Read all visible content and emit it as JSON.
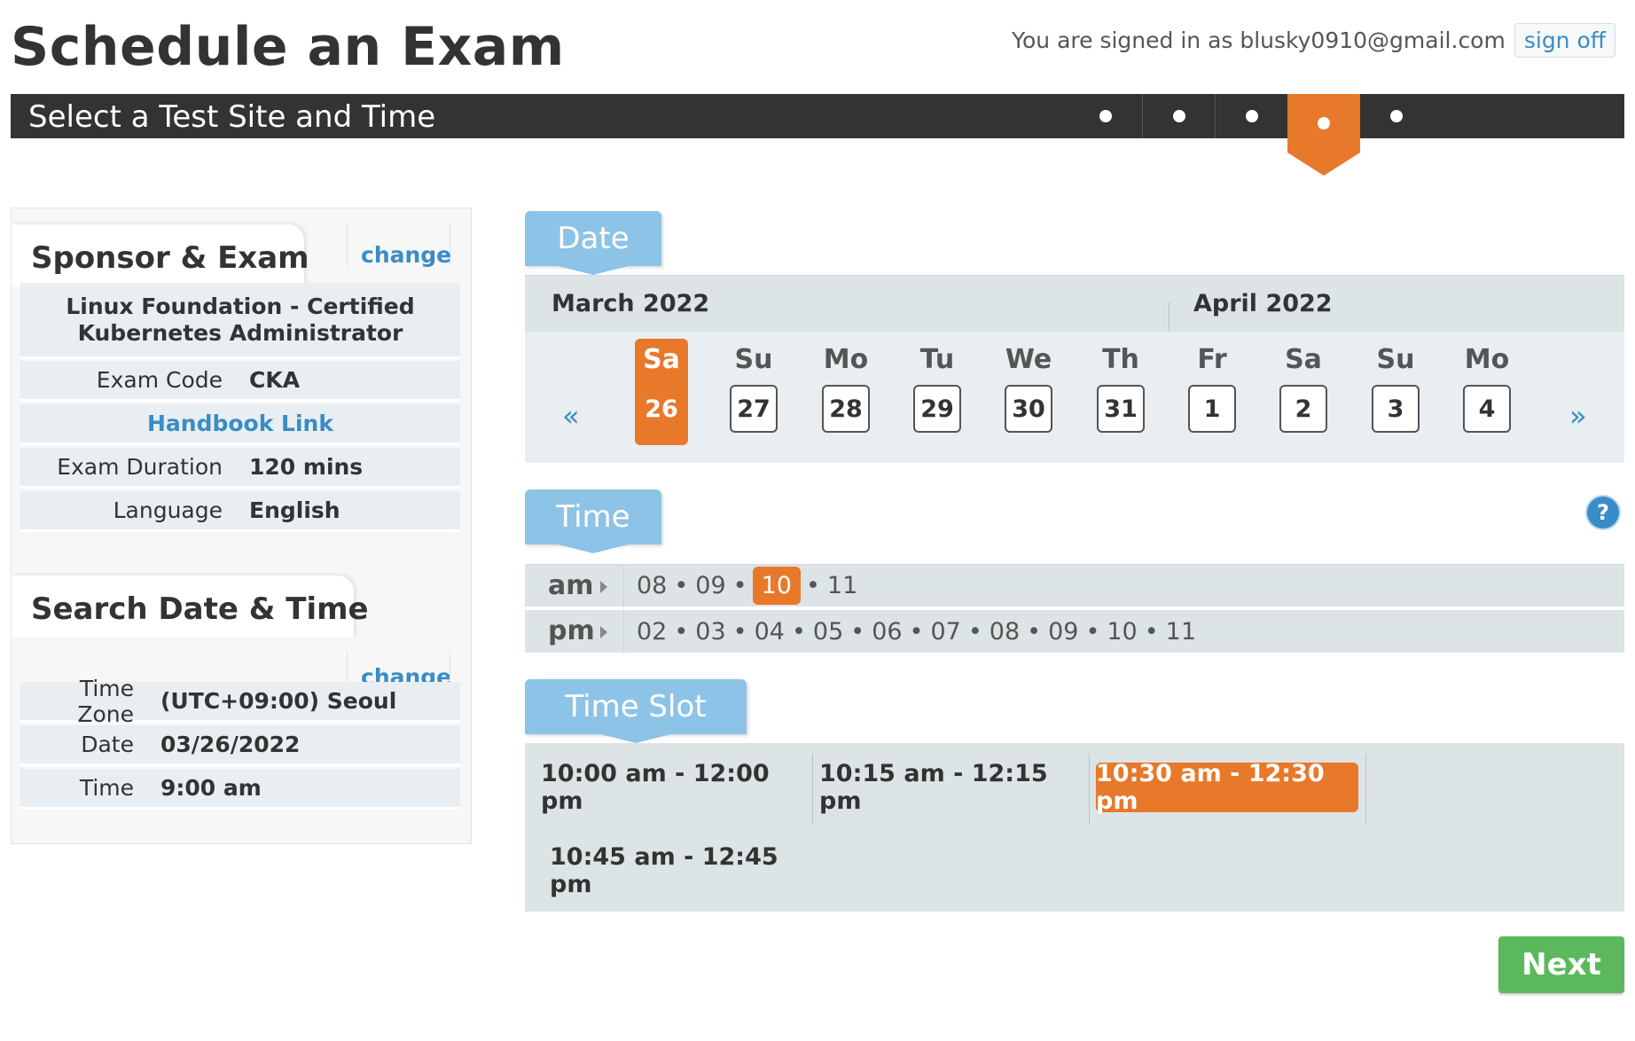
{
  "header": {
    "page_title": "Schedule an Exam",
    "signed_in_text": "You are signed in as blusky0910@gmail.com",
    "sign_off_label": "sign off"
  },
  "stepbar": {
    "title": "Select a Test Site and Time",
    "step_count": 5,
    "active_step": 4
  },
  "sponsor_exam": {
    "heading": "Sponsor & Exam",
    "change_label": "change",
    "exam_name": "Linux Foundation - Certified Kubernetes Administrator",
    "rows": [
      {
        "label": "Exam Code",
        "value": "CKA"
      },
      {
        "label": "Exam Duration",
        "value": "120 mins"
      },
      {
        "label": "Language",
        "value": "English"
      }
    ],
    "handbook_link": "Handbook Link"
  },
  "search": {
    "heading": "Search Date & Time",
    "change_label": "change",
    "rows": [
      {
        "label": "Time Zone",
        "value": "(UTC+09:00) Seoul"
      },
      {
        "label": "Date",
        "value": "03/26/2022"
      },
      {
        "label": "Time",
        "value": "9:00 am"
      }
    ]
  },
  "date": {
    "tab_label": "Date",
    "months": [
      "March 2022",
      "April 2022"
    ],
    "prev_arrow": "«",
    "next_arrow": "»",
    "days": [
      {
        "dow": "Sa",
        "num": "26",
        "selected": true
      },
      {
        "dow": "Su",
        "num": "27"
      },
      {
        "dow": "Mo",
        "num": "28"
      },
      {
        "dow": "Tu",
        "num": "29"
      },
      {
        "dow": "We",
        "num": "30"
      },
      {
        "dow": "Th",
        "num": "31"
      },
      {
        "dow": "Fr",
        "num": "1"
      },
      {
        "dow": "Sa",
        "num": "2"
      },
      {
        "dow": "Su",
        "num": "3"
      },
      {
        "dow": "Mo",
        "num": "4"
      }
    ]
  },
  "time": {
    "tab_label": "Time",
    "help_label": "?",
    "am_label": "am",
    "pm_label": "pm",
    "am_hours": [
      "08",
      "09",
      "10",
      "11"
    ],
    "am_selected": "10",
    "pm_hours": [
      "02",
      "03",
      "04",
      "05",
      "06",
      "07",
      "08",
      "09",
      "10",
      "11"
    ]
  },
  "timeslot": {
    "tab_label": "Time Slot",
    "slots": [
      "10:00 am - 12:00 pm",
      "10:15 am - 12:15 pm",
      "10:30 am - 12:30 pm",
      "10:45 am - 12:45 pm"
    ],
    "selected_index": 2
  },
  "next_label": "Next",
  "colors": {
    "accent_orange": "#e8782a",
    "tab_blue": "#8dc3e6",
    "link_blue": "#3a8cc6",
    "next_green": "#5cb85c",
    "bar_dark": "#333333"
  }
}
